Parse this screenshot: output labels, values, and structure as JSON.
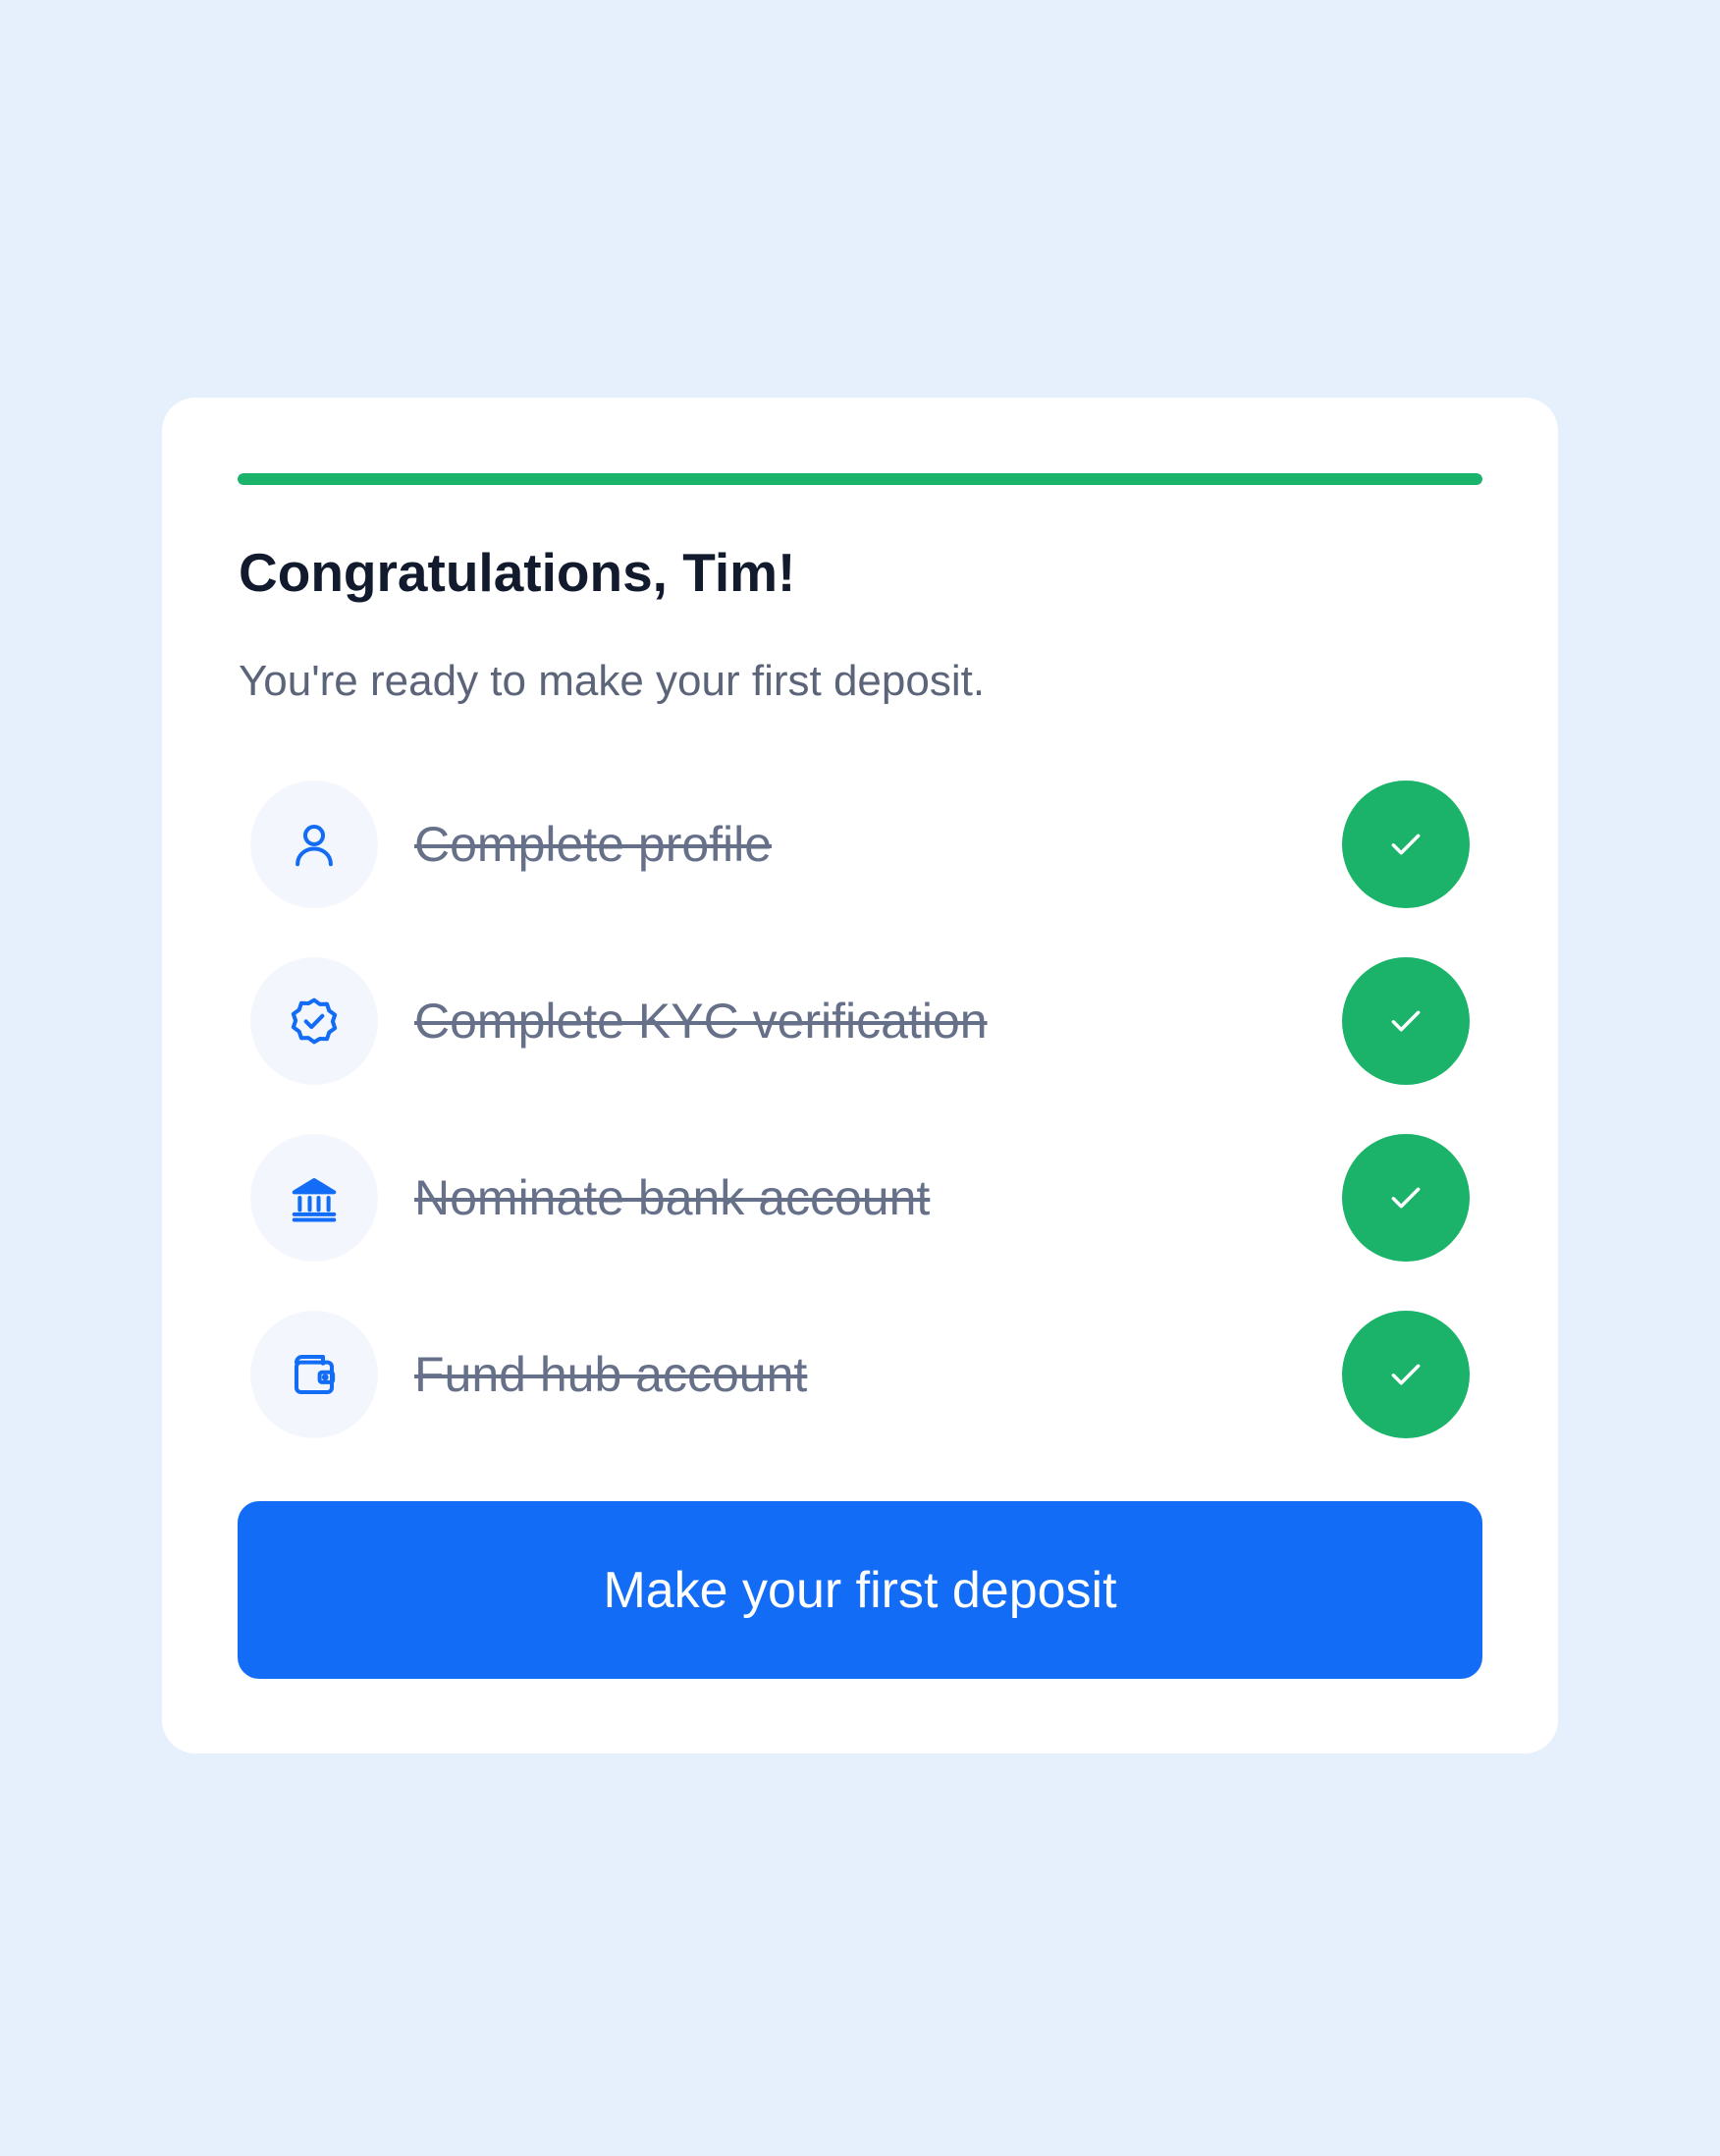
{
  "onboarding": {
    "progress_percent": 100,
    "title": "Congratulations, Tim!",
    "subtitle": "You're ready to make your first deposit.",
    "steps": [
      {
        "label": "Complete profile",
        "icon": "user-icon",
        "completed": true
      },
      {
        "label": "Complete KYC verification",
        "icon": "verified-badge-icon",
        "completed": true
      },
      {
        "label": "Nominate bank account",
        "icon": "bank-icon",
        "completed": true
      },
      {
        "label": "Fund hub account",
        "icon": "wallet-icon",
        "completed": true
      }
    ],
    "cta_label": "Make your first deposit"
  },
  "colors": {
    "background": "#e6f0fc",
    "card": "#ffffff",
    "success": "#1bb26a",
    "primary": "#136cf5",
    "icon_blue": "#136cf5",
    "title_text": "#121a2e",
    "muted_text": "#5b6479",
    "icon_circle_bg": "#f3f7fd"
  }
}
